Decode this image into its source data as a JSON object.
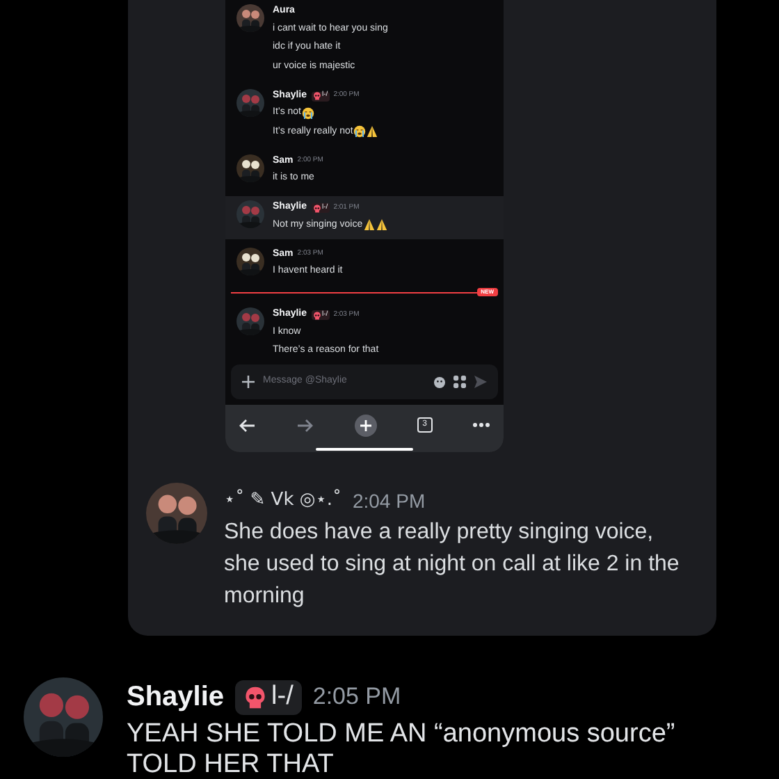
{
  "screenshot": {
    "items": [
      {
        "kind": "message",
        "author": "Aura",
        "highlighted": false,
        "lines": [
          {
            "text": "i cant wait to hear you sing"
          },
          {
            "text": "idc if you hate it"
          },
          {
            "text": "ur voice is majestic"
          }
        ]
      },
      {
        "kind": "message",
        "author": "Shaylie",
        "badge": {
          "text": "l-/"
        },
        "time": "2:00 PM",
        "highlighted": false,
        "lines": [
          {
            "text": "It’s not",
            "emoji": [
              {
                "kind": "sob"
              }
            ]
          },
          {
            "text": "It’s really really not",
            "emoji": [
              {
                "kind": "sob"
              },
              {
                "kind": "pray"
              }
            ]
          }
        ]
      },
      {
        "kind": "message",
        "author": "Sam",
        "time": "2:00 PM",
        "highlighted": false,
        "lines": [
          {
            "text": "it is to me"
          }
        ]
      },
      {
        "kind": "message",
        "author": "Shaylie",
        "badge": {
          "text": "l-/"
        },
        "time": "2:01 PM",
        "highlighted": true,
        "lines": [
          {
            "text": "Not my singing voice",
            "emoji": [
              {
                "kind": "pray"
              },
              {
                "kind": "pray"
              }
            ]
          }
        ]
      },
      {
        "kind": "message",
        "author": "Sam",
        "time": "2:03 PM",
        "highlighted": false,
        "lines": [
          {
            "text": "I havent heard it"
          }
        ]
      },
      {
        "kind": "divider",
        "label": "NEW"
      },
      {
        "kind": "message",
        "author": "Shaylie",
        "badge": {
          "text": "l-/"
        },
        "time": "2:03 PM",
        "highlighted": false,
        "lines": [
          {
            "text": "I know"
          },
          {
            "text": "There’s a reason for that"
          }
        ]
      }
    ],
    "composer": {
      "placeholder": "Message @Shaylie"
    },
    "browser_bar": {
      "tab_count": "3"
    }
  },
  "messages": [
    {
      "author": "⋆˚ ✎ Vk ◎⋆.˚",
      "time": "2:04 PM",
      "text": "She does have a really pretty singing voice, she used to sing at night on call at like 2 in the morning"
    },
    {
      "author": "Shaylie",
      "badge": {
        "text": "l-/"
      },
      "time": "2:05 PM",
      "text": "YEAH SHE TOLD ME AN “anonymous source” TOLD HER THAT"
    }
  ]
}
